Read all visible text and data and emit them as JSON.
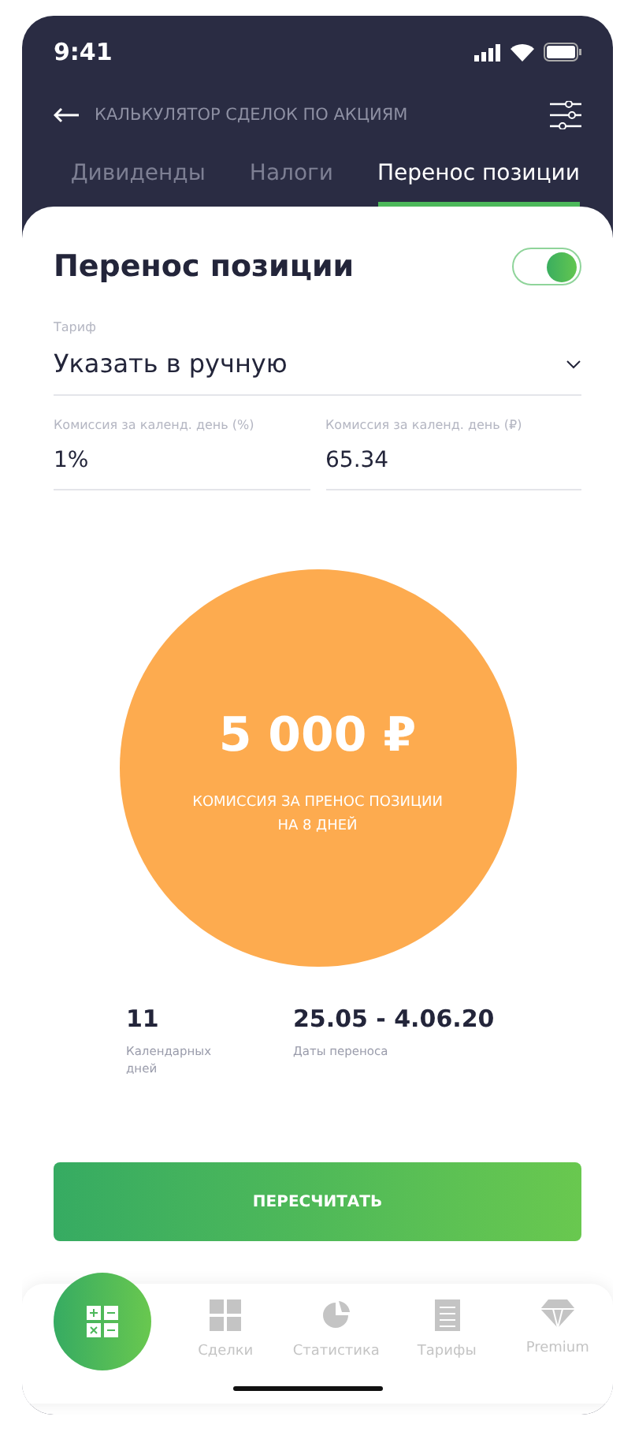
{
  "status_bar": {
    "time": "9:41"
  },
  "header": {
    "title": "КАЛЬКУЛЯТОР СДЕЛОК ПО АКЦИЯМ"
  },
  "tabs": [
    {
      "label": "Дивиденды",
      "selected": false
    },
    {
      "label": "Налоги",
      "selected": false
    },
    {
      "label": "Перенос позиции",
      "selected": true
    }
  ],
  "card": {
    "title": "Перенос позиции",
    "toggle_on": true,
    "tariff": {
      "label": "Тариф",
      "value": "Указать в ручную"
    },
    "fields": [
      {
        "label": "Комиссия за календ. день (%)",
        "value": "1%"
      },
      {
        "label": "Комиссия за календ. день (₽)",
        "value": "65.34"
      }
    ],
    "result": {
      "amount": "5 000 ₽",
      "caption_lines": [
        "КОМИССИЯ ЗА ПРЕНОС ПОЗИЦИИ",
        "НА 8 ДНЕЙ"
      ]
    },
    "stats": [
      {
        "value": "11",
        "label": "Календарных дней"
      },
      {
        "value": "25.05 - 4.06.20",
        "label": "Даты переноса"
      }
    ],
    "button": "ПЕРЕСЧИТАТЬ"
  },
  "bottom_nav": [
    {
      "kind": "calculator",
      "selected": true
    },
    {
      "kind": "grid",
      "label": "Сделки",
      "selected": false
    },
    {
      "kind": "pie",
      "label": "Статистика",
      "selected": false
    },
    {
      "kind": "list",
      "label": "Тарифы",
      "selected": false
    },
    {
      "kind": "diamond",
      "label": "Premium",
      "selected": false
    }
  ]
}
